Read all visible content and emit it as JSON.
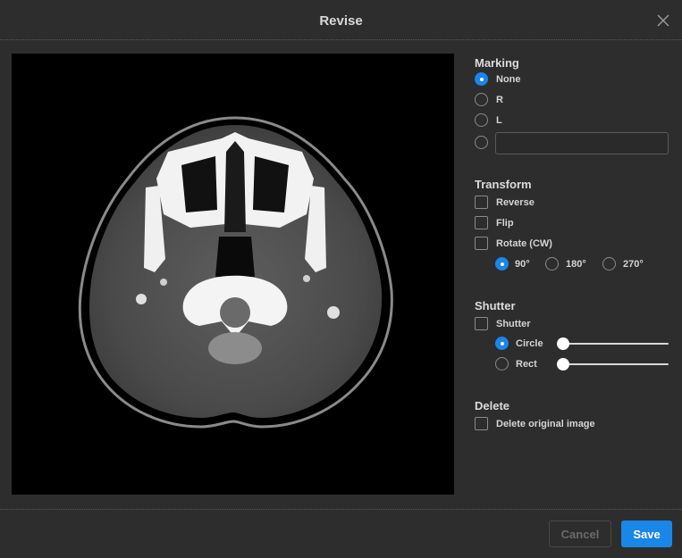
{
  "dialog": {
    "title": "Revise",
    "close_icon": "close-icon"
  },
  "marking": {
    "title": "Marking",
    "options": [
      {
        "label": "None",
        "selected": true
      },
      {
        "label": "R",
        "selected": false
      },
      {
        "label": "L",
        "selected": false
      },
      {
        "label": "",
        "selected": false
      }
    ],
    "custom_value": ""
  },
  "transform": {
    "title": "Transform",
    "reverse_label": "Reverse",
    "flip_label": "Flip",
    "rotate_label": "Rotate (CW)",
    "rotations": [
      {
        "label": "90°",
        "selected": true
      },
      {
        "label": "180°",
        "selected": false
      },
      {
        "label": "270°",
        "selected": false
      }
    ]
  },
  "shutter": {
    "title": "Shutter",
    "shutter_label": "Shutter",
    "circle_label": "Circle",
    "rect_label": "Rect",
    "circle_selected": true,
    "circle_value": 0,
    "rect_value": 0
  },
  "delete": {
    "title": "Delete",
    "delete_original_label": "Delete original image"
  },
  "footer": {
    "cancel_label": "Cancel",
    "save_label": "Save"
  },
  "colors": {
    "accent": "#1a86e8",
    "background": "#2d2d2d"
  }
}
